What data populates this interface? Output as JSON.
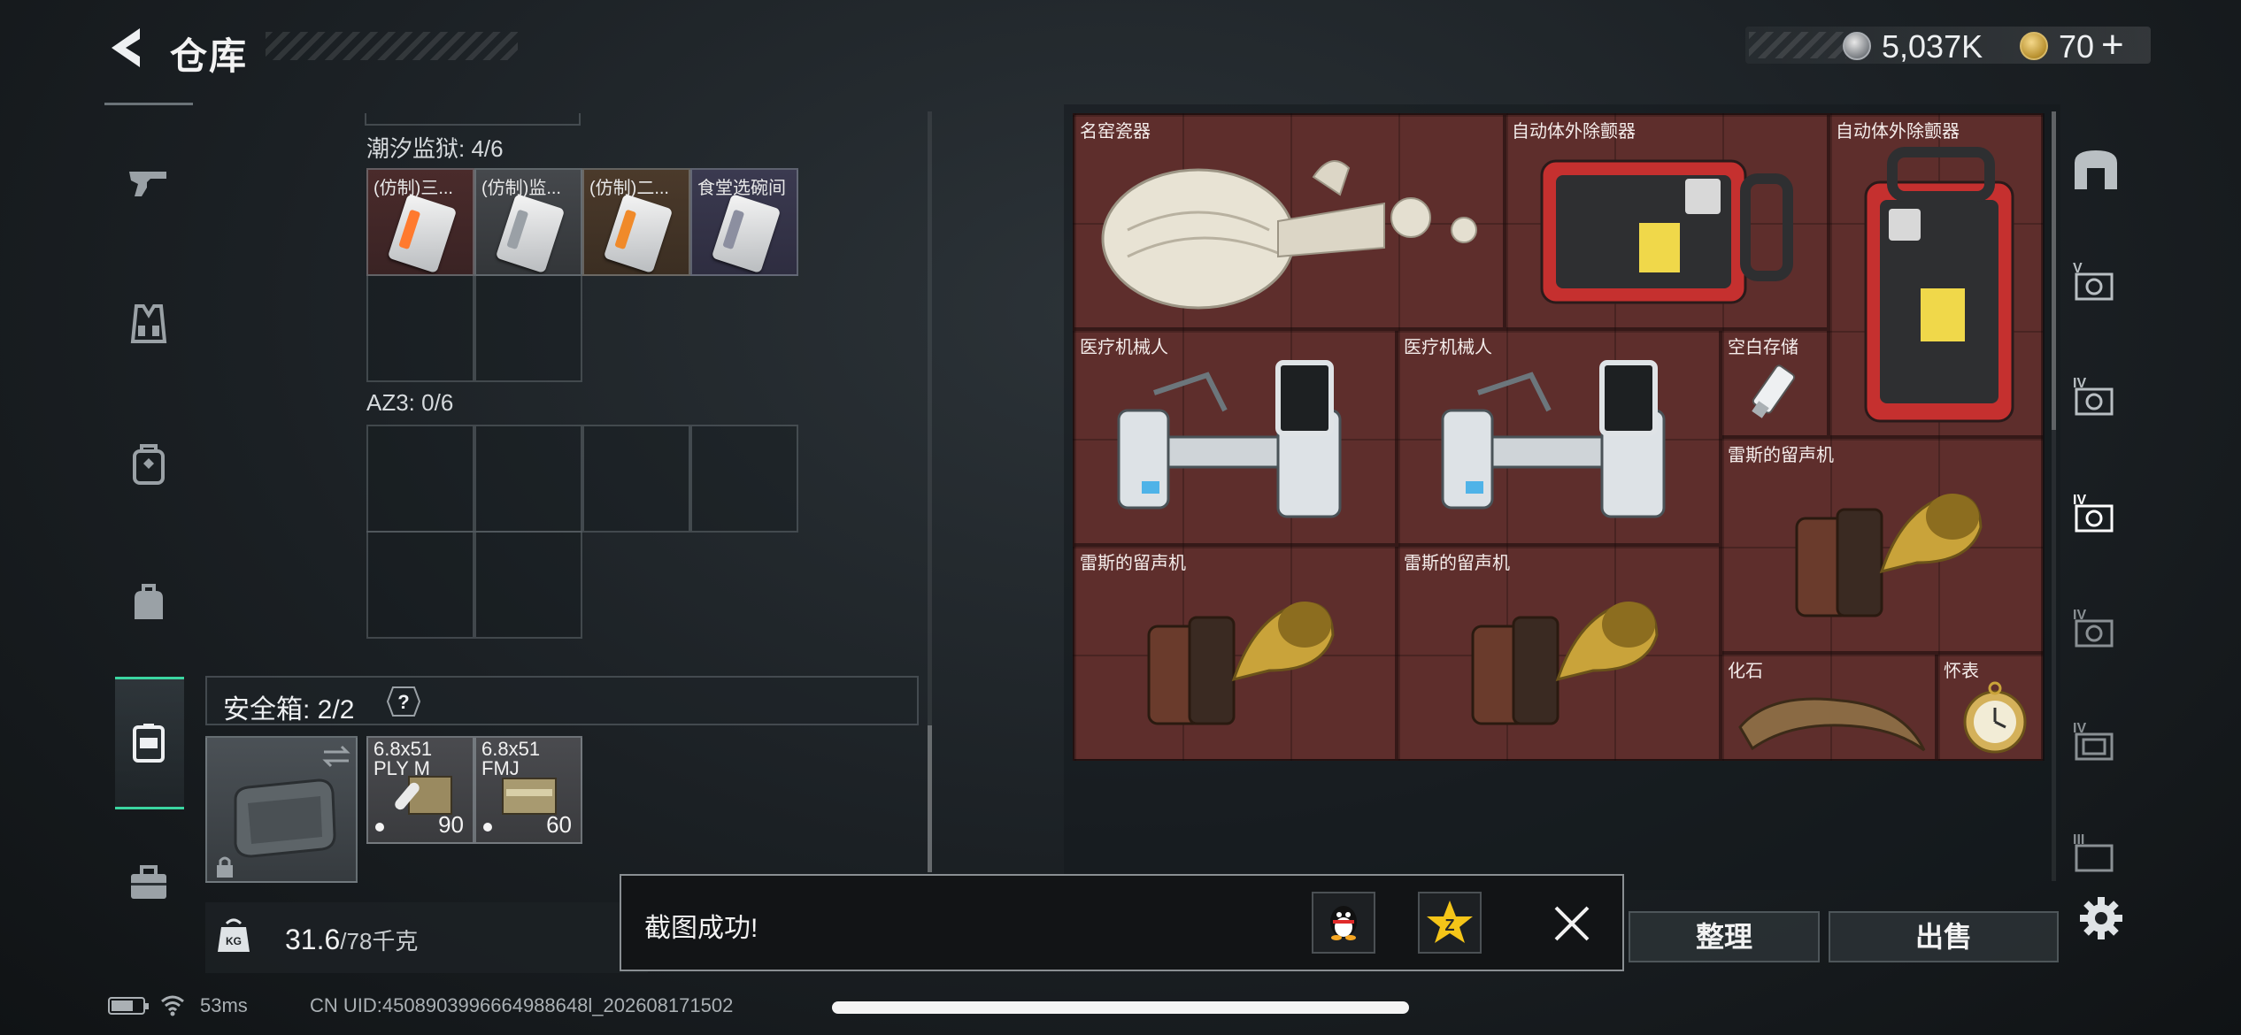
{
  "header": {
    "title": "仓库",
    "currency": {
      "silver": "5,037K",
      "gold": "70"
    },
    "plus": "+"
  },
  "sidebar": {
    "items": [
      {
        "icon": "pistol-icon",
        "active": false
      },
      {
        "icon": "vest-icon",
        "active": false
      },
      {
        "icon": "backpack-icon",
        "active": false
      },
      {
        "icon": "bag-icon",
        "active": false
      },
      {
        "icon": "safe-case-icon",
        "active": true
      },
      {
        "icon": "toolbox-icon",
        "active": false
      }
    ]
  },
  "storage": {
    "section1": {
      "label": "潮汐监狱: 4/6",
      "items": [
        {
          "name": "(仿制)三...",
          "bg": "red"
        },
        {
          "name": "(仿制)监...",
          "bg": "gray"
        },
        {
          "name": "(仿制)二...",
          "bg": "orange"
        },
        {
          "name": "食堂选碗间",
          "bg": "purple"
        }
      ]
    },
    "section2": {
      "label": "AZ3: 0/6"
    },
    "safe": {
      "label": "安全箱: 2/2",
      "ammo": [
        {
          "name": "6.8x51\nPLY M",
          "count": "90"
        },
        {
          "name": "6.8x51\nFMJ",
          "count": "60"
        }
      ]
    },
    "weight": {
      "current": "31.6",
      "max": "/78千克"
    }
  },
  "container": {
    "items": [
      {
        "name": "名窑瓷器"
      },
      {
        "name": "自动体外除颤器"
      },
      {
        "name": "自动体外除颤器"
      },
      {
        "name": "医疗机械人"
      },
      {
        "name": "医疗机械人"
      },
      {
        "name": "空白存储"
      },
      {
        "name": "雷斯的留声机"
      },
      {
        "name": "雷斯的留声机"
      },
      {
        "name": "雷斯的留声机"
      },
      {
        "name": "化石"
      },
      {
        "name": "怀表"
      }
    ],
    "tiers": [
      "V",
      "IV",
      "IV",
      "IV",
      "IV",
      "III"
    ]
  },
  "actions": {
    "sort": "整理",
    "sell": "出售"
  },
  "toast": {
    "text": "截图成功!"
  },
  "status": {
    "ping": "53ms",
    "uid": "CN UID:4508903996664988648l_202608171502"
  },
  "colors": {
    "accent": "#3bd6a1",
    "container_bg": "#5e2e2c"
  }
}
